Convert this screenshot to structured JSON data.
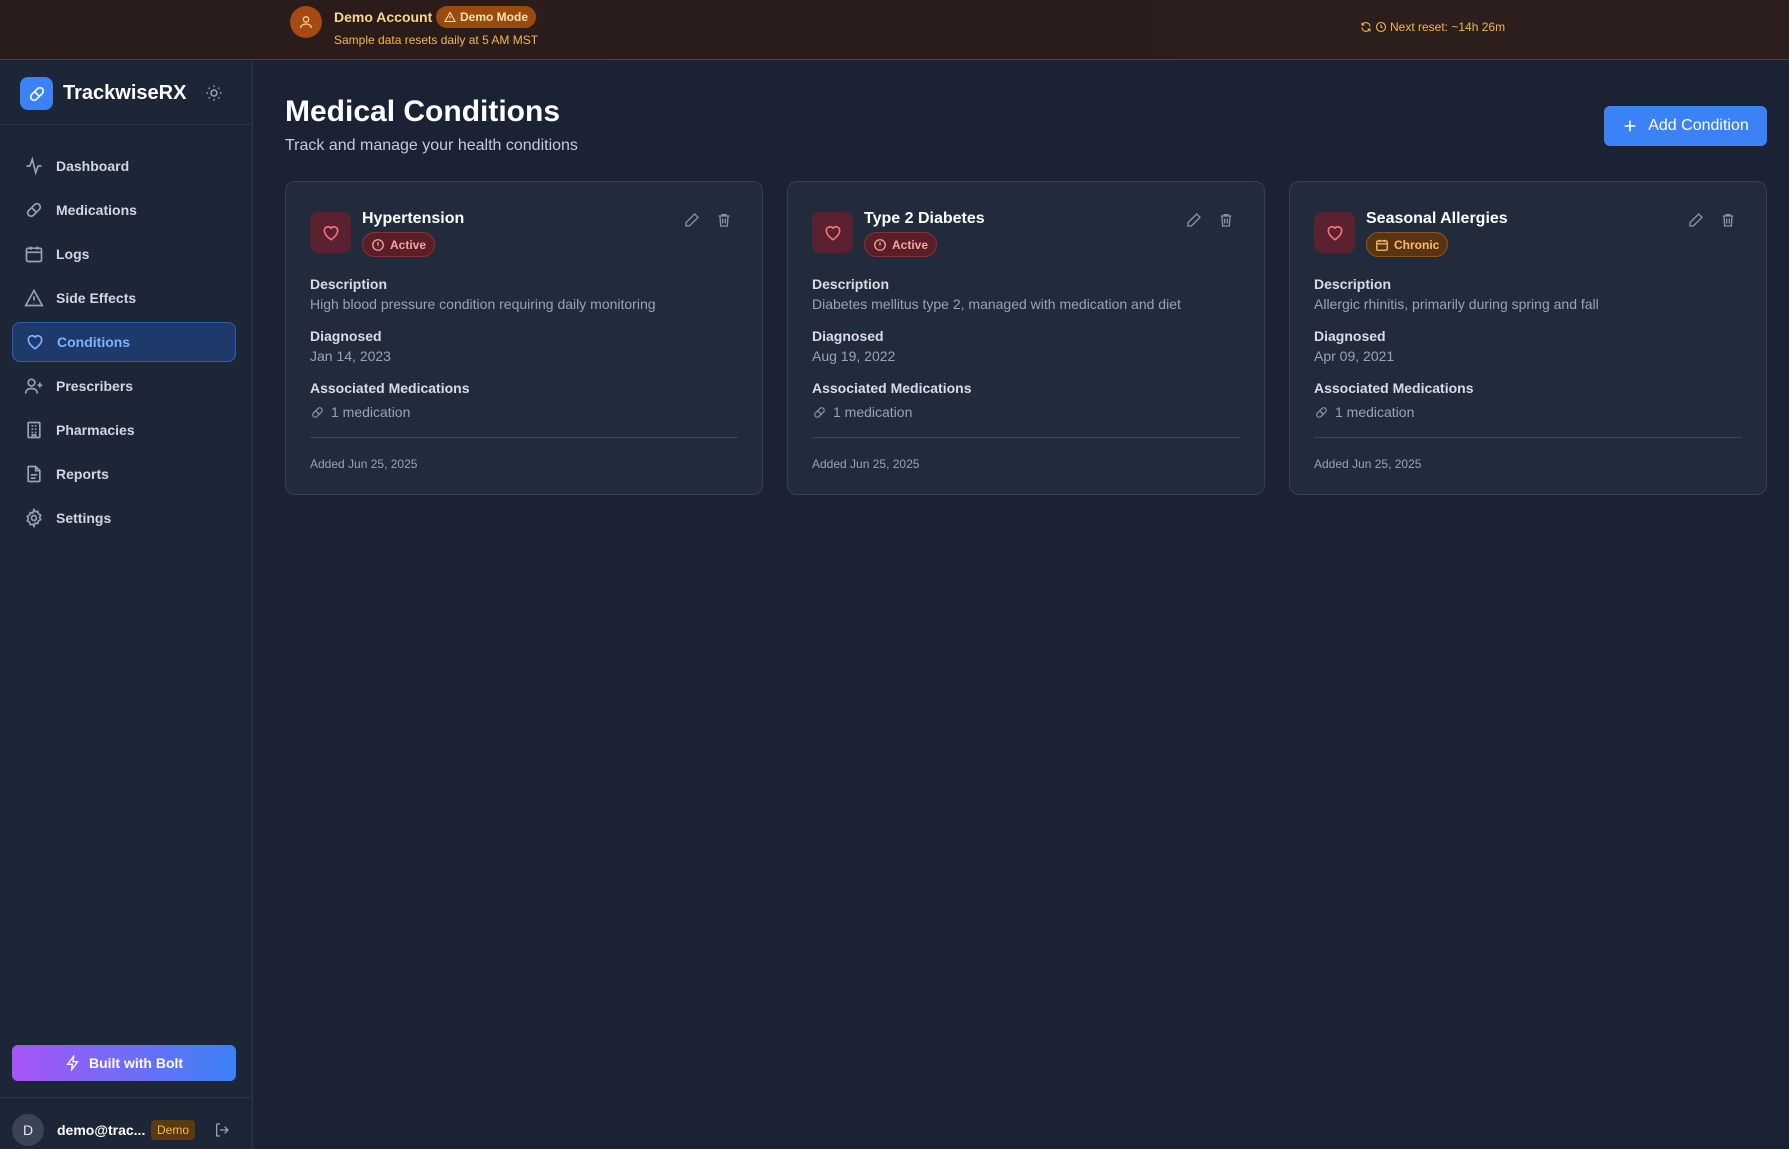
{
  "banner": {
    "account_name": "Demo Account",
    "mode_badge": "Demo Mode",
    "subtitle": "Sample data resets daily at 5 AM MST",
    "reset_text": "Next reset: ~14h 26m",
    "accent": "#f4b64a"
  },
  "sidebar": {
    "brand": "TrackwiseRX",
    "items": [
      {
        "label": "Dashboard",
        "icon": "activity-icon"
      },
      {
        "label": "Medications",
        "icon": "pill-icon"
      },
      {
        "label": "Logs",
        "icon": "calendar-icon"
      },
      {
        "label": "Side Effects",
        "icon": "alert-triangle-icon"
      },
      {
        "label": "Conditions",
        "icon": "heart-icon",
        "active": true
      },
      {
        "label": "Prescribers",
        "icon": "user-plus-icon"
      },
      {
        "label": "Pharmacies",
        "icon": "building-icon"
      },
      {
        "label": "Reports",
        "icon": "file-text-icon"
      },
      {
        "label": "Settings",
        "icon": "gear-icon"
      }
    ],
    "bolt_label": "Built with Bolt",
    "user": {
      "initial": "D",
      "email": "demo@trac...",
      "tag": "Demo"
    }
  },
  "page": {
    "title": "Medical Conditions",
    "subtitle": "Track and manage your health conditions",
    "add_label": "Add Condition"
  },
  "labels": {
    "description": "Description",
    "diagnosed": "Diagnosed",
    "associated": "Associated Medications"
  },
  "conditions": [
    {
      "name": "Hypertension",
      "status": "Active",
      "description": "High blood pressure condition requiring daily monitoring",
      "diagnosed": "Jan 14, 2023",
      "medications": "1 medication",
      "added": "Added Jun 25, 2025"
    },
    {
      "name": "Type 2 Diabetes",
      "status": "Active",
      "description": "Diabetes mellitus type 2, managed with medication and diet",
      "diagnosed": "Aug 19, 2022",
      "medications": "1 medication",
      "added": "Added Jun 25, 2025"
    },
    {
      "name": "Seasonal Allergies",
      "status": "Chronic",
      "description": "Allergic rhinitis, primarily during spring and fall",
      "diagnosed": "Apr 09, 2021",
      "medications": "1 medication",
      "added": "Added Jun 25, 2025"
    }
  ]
}
